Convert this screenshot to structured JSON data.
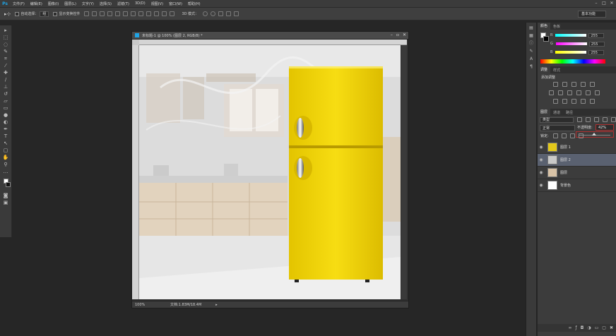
{
  "menubar": {
    "logo": "Ps",
    "items": [
      "文件(F)",
      "编辑(E)",
      "图像(I)",
      "图层(L)",
      "文字(Y)",
      "选择(S)",
      "滤镜(T)",
      "3D(D)",
      "视图(V)",
      "窗口(W)",
      "帮助(H)"
    ]
  },
  "optbar": {
    "auto_select_label": "自动选择：",
    "auto_select_value": "组",
    "show_transform_label": "显示变换控件",
    "mode_3d_label": "3D 模式：",
    "workspace": "基本功能"
  },
  "document": {
    "title": "未标题-1 @ 100% (图层 2, RGB/8) *",
    "zoom": "100%",
    "doc_info": "文档:1.83M/18.4M"
  },
  "color_panel": {
    "tabs": [
      "颜色",
      "色板"
    ],
    "r_label": "R",
    "r_value": "255",
    "g_label": "G",
    "g_value": "255",
    "b_label": "B",
    "b_value": "255"
  },
  "adjust_panel": {
    "tabs": [
      "调整",
      "样式"
    ],
    "heading": "添加调整"
  },
  "layers_panel": {
    "tabs": [
      "图层",
      "通道",
      "路径"
    ],
    "kind_label": "类型",
    "blend_mode": "正常",
    "opacity_label": "不透明度:",
    "opacity_value": "42%",
    "lock_label": "锁定:",
    "layers": [
      {
        "name": "图层 1",
        "thumb_color": "#e3c81a",
        "selected": false
      },
      {
        "name": "图层 2",
        "thumb_color": "#c9c9c9",
        "selected": true
      },
      {
        "name": "图层",
        "thumb_color": "#d8c2a6",
        "selected": false
      },
      {
        "name": "背景色",
        "thumb_color": "#ffffff",
        "selected": false
      }
    ]
  },
  "colors": {
    "fridge": "#f2d20a",
    "fridge_dark": "#c9a800",
    "selection_blue": "#5a6170"
  }
}
